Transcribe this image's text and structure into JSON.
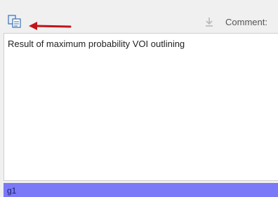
{
  "toolbar": {
    "copy_icon": "copy-documents-icon",
    "annotation_arrow": "red-left-arrow",
    "download_icon": "download-arrow-icon",
    "comment_label": "Comment:"
  },
  "editor": {
    "text": "Result of maximum probability VOI outlining"
  },
  "list": {
    "selected_item": "g1"
  },
  "colors": {
    "arrow": "#c0151a",
    "selection": "#7a79f7",
    "copy_icon": "#3a6fb0"
  }
}
